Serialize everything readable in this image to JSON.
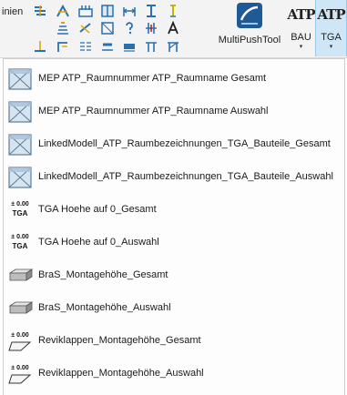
{
  "ribbon": {
    "partial_label": "inien",
    "multipushtool_label": "MultiPushTool",
    "bau_button": {
      "logo_text": "ATP",
      "label": "BAU",
      "caret": "▾"
    },
    "tga_button": {
      "logo_text": "ATP",
      "label": "TGA",
      "caret": "▾"
    },
    "accent": "#cfe6f6"
  },
  "menu": {
    "items": [
      {
        "label": "MEP ATP_Raumnummer ATP_Raumname Gesamt",
        "icon": "section-box-icon"
      },
      {
        "label": "MEP ATP_Raumnummer ATP_Raumname Auswahl",
        "icon": "section-box-icon"
      },
      {
        "label": "LinkedModell_ATP_Raumbezeichnungen_TGA_Bauteile_Gesamt",
        "icon": "section-box-icon"
      },
      {
        "label": "LinkedModell_ATP_Raumbezeichnungen_TGA_Bauteile_Auswahl",
        "icon": "section-box-icon"
      },
      {
        "label": "TGA Hoehe auf 0_Gesamt",
        "icon": "elevation-tga-icon",
        "icon_top": "± 0.00",
        "icon_bottom": "TGA"
      },
      {
        "label": "TGA Hoehe auf 0_Auswahl",
        "icon": "elevation-tga-icon",
        "icon_top": "± 0.00",
        "icon_bottom": "TGA"
      },
      {
        "label": "BraS_Montagehöhe_Gesamt",
        "icon": "beam-icon"
      },
      {
        "label": "BraS_Montagehöhe_Auswahl",
        "icon": "beam-icon"
      },
      {
        "label": "Reviklappen_Montagehöhe_Gesamt",
        "icon": "elevation-flap-icon",
        "icon_top": "± 0.00"
      },
      {
        "label": "Reviklappen_Montagehöhe_Auswahl",
        "icon": "elevation-flap-icon",
        "icon_top": "± 0.00"
      }
    ]
  }
}
